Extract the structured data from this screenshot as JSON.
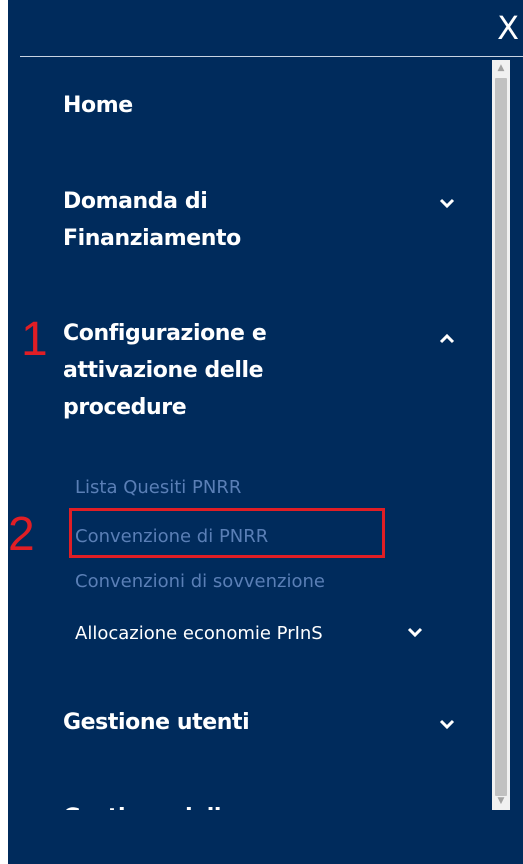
{
  "header": {
    "close_label": "X"
  },
  "menu": {
    "items": [
      {
        "label": "Home"
      },
      {
        "label": "Domanda di Finanziamento"
      },
      {
        "label": "Configurazione e attivazione delle procedure"
      },
      {
        "label": "Gestione utenti"
      },
      {
        "label": "Gestione delle assegnazioni"
      }
    ],
    "subitems": [
      {
        "label": "Lista Quesiti PNRR"
      },
      {
        "label": "Convenzione di PNRR"
      },
      {
        "label": "Convenzioni di sovvenzione"
      },
      {
        "label": "Allocazione economie PrInS"
      }
    ]
  },
  "annotations": {
    "marker_1": "1",
    "marker_2": "2"
  },
  "colors": {
    "panel_bg": "#002b5c",
    "text": "#ffffff",
    "subitem_link": "#5a7fb6",
    "annotation_red": "#e01e25"
  }
}
